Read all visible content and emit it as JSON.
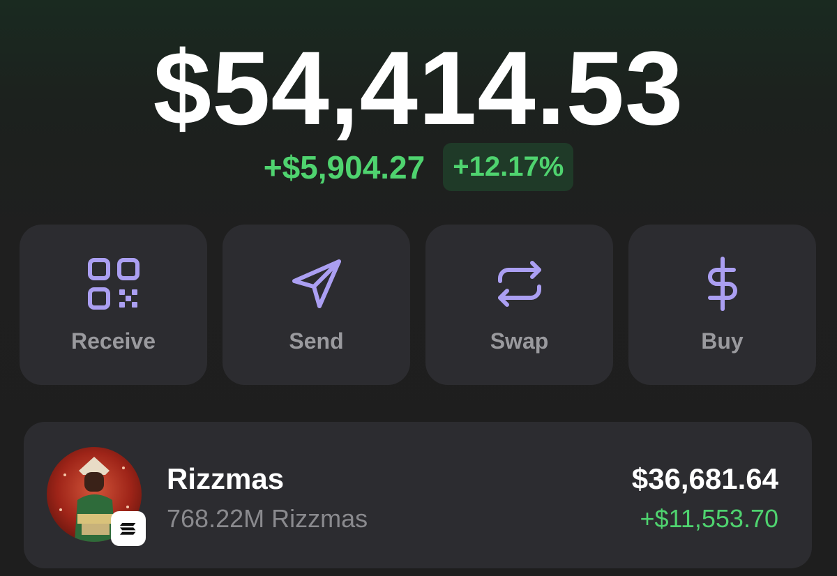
{
  "portfolio": {
    "balance": "$54,414.53",
    "change_amount": "+$5,904.27",
    "change_percent": "+12.17%"
  },
  "actions": [
    {
      "label": "Receive",
      "icon": "qr-code-icon"
    },
    {
      "label": "Send",
      "icon": "send-icon"
    },
    {
      "label": "Swap",
      "icon": "swap-icon"
    },
    {
      "label": "Buy",
      "icon": "dollar-icon"
    }
  ],
  "tokens": [
    {
      "name": "Rizzmas",
      "amount": "768.22M Rizzmas",
      "value": "$36,681.64",
      "change": "+$11,553.70",
      "chain_icon": "solana-icon"
    }
  ],
  "colors": {
    "accent": "#ab9ff2",
    "positive": "#4fd36f",
    "card": "#2c2c30"
  }
}
